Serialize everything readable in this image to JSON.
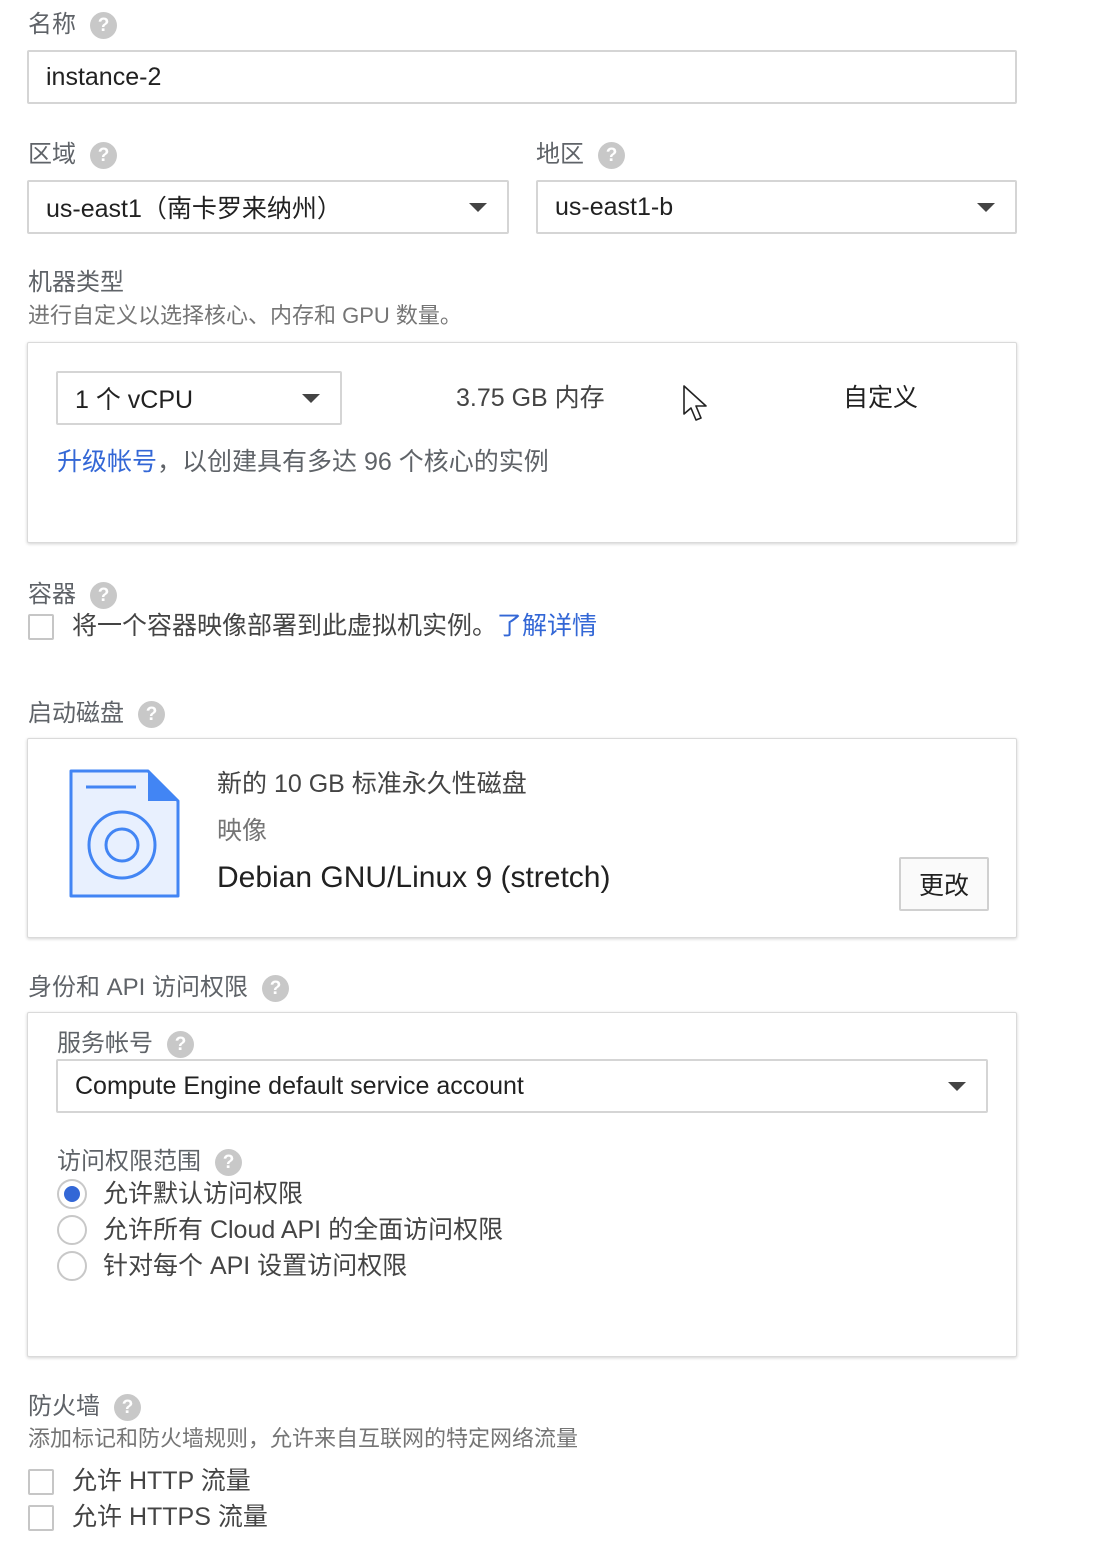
{
  "name_section": {
    "label": "名称",
    "value": "instance-2"
  },
  "region": {
    "label": "区域",
    "value": "us-east1（南卡罗来纳州）"
  },
  "zone": {
    "label": "地区",
    "value": "us-east1-b"
  },
  "machine_type": {
    "label": "机器类型",
    "description": "进行自定义以选择核心、内存和 GPU 数量。",
    "cpu_value": "1 个 vCPU",
    "memory_text": "3.75 GB 内存",
    "customize_link": "自定义",
    "upgrade_link": "升级帐号",
    "upgrade_text": "，以创建具有多达 96 个核心的实例"
  },
  "container": {
    "label": "容器",
    "checkbox_text": "将一个容器映像部署到此虚拟机实例。",
    "learn_more_link": "了解详情",
    "checked": false
  },
  "boot_disk": {
    "label": "启动磁盘",
    "disk_desc": "新的 10 GB 标准永久性磁盘",
    "image_label": "映像",
    "image_name": "Debian GNU/Linux 9 (stretch)",
    "change_button": "更改",
    "icon": "disk-image-icon"
  },
  "identity": {
    "label": "身份和 API 访问权限",
    "service_account_label": "服务帐号",
    "service_account_value": "Compute Engine default service account",
    "scopes_label": "访问权限范围",
    "scope_options": [
      {
        "label": "允许默认访问权限",
        "checked": true
      },
      {
        "label": "允许所有 Cloud API 的全面访问权限",
        "checked": false
      },
      {
        "label": "针对每个 API 设置访问权限",
        "checked": false
      }
    ]
  },
  "firewall": {
    "label": "防火墙",
    "description": "添加标记和防火墙规则，允许来自互联网的特定网络流量",
    "options": [
      {
        "label": "允许 HTTP 流量",
        "checked": false
      },
      {
        "label": "允许 HTTPS 流量",
        "checked": false
      }
    ]
  },
  "help_glyph": "?",
  "colors": {
    "link": "#3367d6",
    "radio_checked": "#3367d6",
    "border": "#d5d5d5"
  }
}
